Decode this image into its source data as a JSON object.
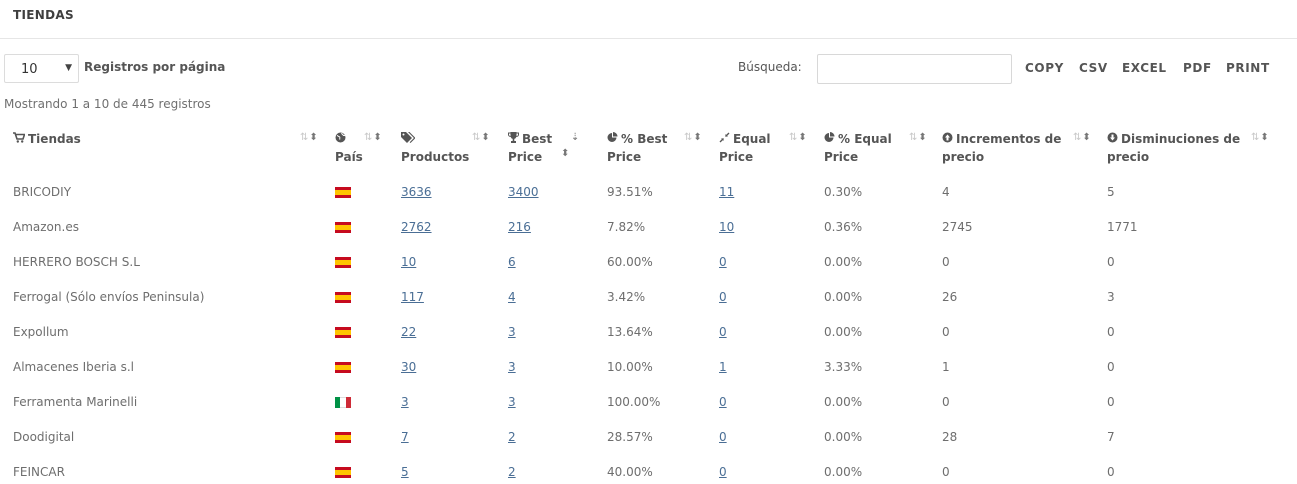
{
  "header": {
    "title": "TIENDAS"
  },
  "controls": {
    "page_length": "10",
    "page_length_label": "Registros por página",
    "search_label": "Búsqueda:",
    "search_value": "",
    "export_buttons": [
      "COPY",
      "CSV",
      "EXCEL",
      "PDF",
      "PRINT"
    ]
  },
  "info": "Mostrando 1 a 10 de 445 registros",
  "icons": {
    "tiendas": "shopping-cart-icon",
    "pais": "globe-icon",
    "productos": "tags-icon",
    "best_price": "trophy-icon",
    "pct_best": "pie-chart-icon",
    "equal_price": "compress-icon",
    "pct_equal": "pie-chart-icon",
    "incrementos": "arrow-circle-up-icon",
    "disminuciones": "arrow-circle-down-icon"
  },
  "columns": [
    {
      "key": "tiendas",
      "line1": "Tiendas",
      "line2": ""
    },
    {
      "key": "pais",
      "line1": "",
      "line2": "País"
    },
    {
      "key": "productos",
      "line1": "",
      "line2": "Productos"
    },
    {
      "key": "best_price",
      "line1": "Best",
      "line2": "Price"
    },
    {
      "key": "pct_best",
      "line1": "% Best",
      "line2": "Price"
    },
    {
      "key": "equal_price",
      "line1": "Equal",
      "line2": "Price"
    },
    {
      "key": "pct_equal",
      "line1": "% Equal",
      "line2": "Price"
    },
    {
      "key": "incrementos",
      "line1": "Incrementos de",
      "line2": "precio"
    },
    {
      "key": "disminuciones",
      "line1": "Disminuciones de",
      "line2": "precio"
    }
  ],
  "rows": [
    {
      "tienda": "BRICODIY",
      "country": "es",
      "productos": "3636",
      "best_price": "3400",
      "pct_best": "93.51%",
      "equal_price": "11",
      "pct_equal": "0.30%",
      "incrementos": "4",
      "disminuciones": "5"
    },
    {
      "tienda": "Amazon.es",
      "country": "es",
      "productos": "2762",
      "best_price": "216",
      "pct_best": "7.82%",
      "equal_price": "10",
      "pct_equal": "0.36%",
      "incrementos": "2745",
      "disminuciones": "1771"
    },
    {
      "tienda": "HERRERO BOSCH S.L",
      "country": "es",
      "productos": "10",
      "best_price": "6",
      "pct_best": "60.00%",
      "equal_price": "0",
      "pct_equal": "0.00%",
      "incrementos": "0",
      "disminuciones": "0"
    },
    {
      "tienda": "Ferrogal (Sólo envíos Peninsula)",
      "country": "es",
      "productos": "117",
      "best_price": "4",
      "pct_best": "3.42%",
      "equal_price": "0",
      "pct_equal": "0.00%",
      "incrementos": "26",
      "disminuciones": "3"
    },
    {
      "tienda": "Expollum",
      "country": "es",
      "productos": "22",
      "best_price": "3",
      "pct_best": "13.64%",
      "equal_price": "0",
      "pct_equal": "0.00%",
      "incrementos": "0",
      "disminuciones": "0"
    },
    {
      "tienda": "Almacenes Iberia s.l",
      "country": "es",
      "productos": "30",
      "best_price": "3",
      "pct_best": "10.00%",
      "equal_price": "1",
      "pct_equal": "3.33%",
      "incrementos": "1",
      "disminuciones": "0"
    },
    {
      "tienda": "Ferramenta Marinelli",
      "country": "it",
      "productos": "3",
      "best_price": "3",
      "pct_best": "100.00%",
      "equal_price": "0",
      "pct_equal": "0.00%",
      "incrementos": "0",
      "disminuciones": "0"
    },
    {
      "tienda": "Doodigital",
      "country": "es",
      "productos": "7",
      "best_price": "2",
      "pct_best": "28.57%",
      "equal_price": "0",
      "pct_equal": "0.00%",
      "incrementos": "28",
      "disminuciones": "7"
    },
    {
      "tienda": "FEINCAR",
      "country": "es",
      "productos": "5",
      "best_price": "2",
      "pct_best": "40.00%",
      "equal_price": "0",
      "pct_equal": "0.00%",
      "incrementos": "0",
      "disminuciones": "0"
    }
  ]
}
